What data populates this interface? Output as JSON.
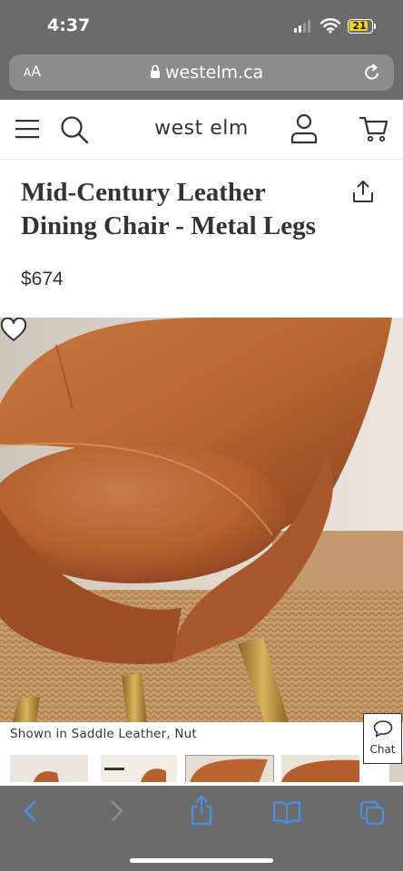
{
  "status_bar": {
    "time": "4:37",
    "battery_level": "21"
  },
  "browser": {
    "aa_small": "A",
    "aa_large": "A",
    "url": "westelm.ca"
  },
  "site": {
    "brand": "west elm"
  },
  "product": {
    "title": "Mid-Century Leather Dining Chair - Metal Legs",
    "price": "$674",
    "caption": "Shown in Saddle Leather, Nut",
    "thumbnail_count": 4,
    "selected_thumbnail": 3
  },
  "chat": {
    "label": "Chat"
  },
  "colors": {
    "leather": "#b8673a",
    "brass": "#b98f3a",
    "chrome_gray": "#6b6b6b",
    "safari_blue": "#4a8fe0"
  },
  "icons": [
    "menu-icon",
    "search-icon",
    "account-icon",
    "cart-icon",
    "share-icon",
    "heart-icon",
    "chat-icon",
    "lock-icon",
    "reload-icon",
    "back-icon",
    "forward-icon",
    "bookmarks-icon",
    "tabs-icon"
  ]
}
